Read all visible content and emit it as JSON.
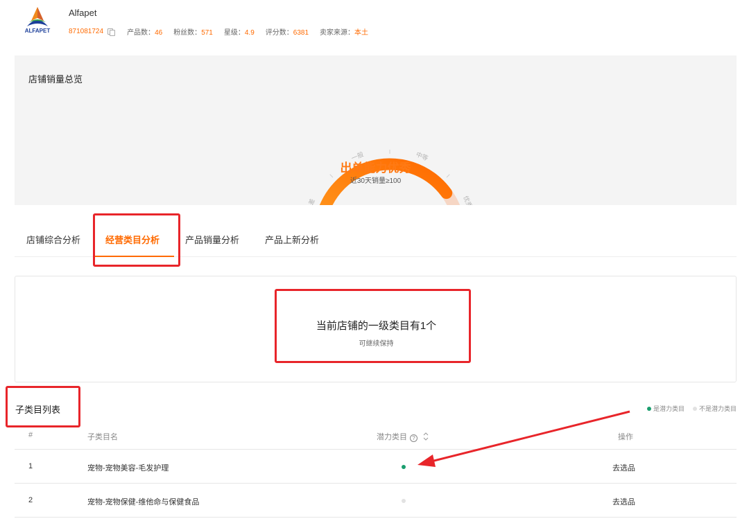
{
  "store": {
    "logo_text": "ALFAPET",
    "name": "Alfapet",
    "id": "871081724",
    "stats": [
      {
        "label": "产品数：",
        "value": "46"
      },
      {
        "label": "粉丝数：",
        "value": "571"
      },
      {
        "label": "星级：",
        "value": "4.9"
      },
      {
        "label": "评分数：",
        "value": "6381"
      },
      {
        "label": "卖家来源：",
        "value": "本土"
      }
    ]
  },
  "overview": {
    "title": "店铺销量总览",
    "gauge": {
      "segments": [
        "差",
        "一般",
        "中等",
        "优秀"
      ],
      "level": "优秀",
      "fill_fraction": 0.8,
      "result": "出单能力优秀",
      "note": "近30天销量≥100"
    }
  },
  "tabs": [
    {
      "label": "店铺综合分析",
      "active": false
    },
    {
      "label": "经营类目分析",
      "active": true
    },
    {
      "label": "产品销量分析",
      "active": false
    },
    {
      "label": "产品上新分析",
      "active": false
    }
  ],
  "summary": {
    "main": "当前店铺的一级类目有1个",
    "sub": "可继续保持"
  },
  "subcategories": {
    "title": "子类目列表",
    "legend": {
      "potential": "是潜力类目",
      "not_potential": "不是潜力类目"
    },
    "columns": {
      "index": "#",
      "name": "子类目名",
      "potential": "潜力类目",
      "action": "操作"
    },
    "rows": [
      {
        "index": "1",
        "name": "宠物-宠物美容-毛发护理",
        "potential": true,
        "action": "去选品"
      },
      {
        "index": "2",
        "name": "宠物-宠物保健-维他命与保健食品",
        "potential": false,
        "action": "去选品"
      }
    ]
  },
  "colors": {
    "accent": "#ff6a00",
    "potential_dot": "#1a9e6e",
    "not_potential_dot": "#e2e2e2",
    "annotation_red": "#e8252a"
  },
  "icons": {
    "copy": "copy-icon",
    "help": "help-icon",
    "sort": "sort-icon"
  }
}
